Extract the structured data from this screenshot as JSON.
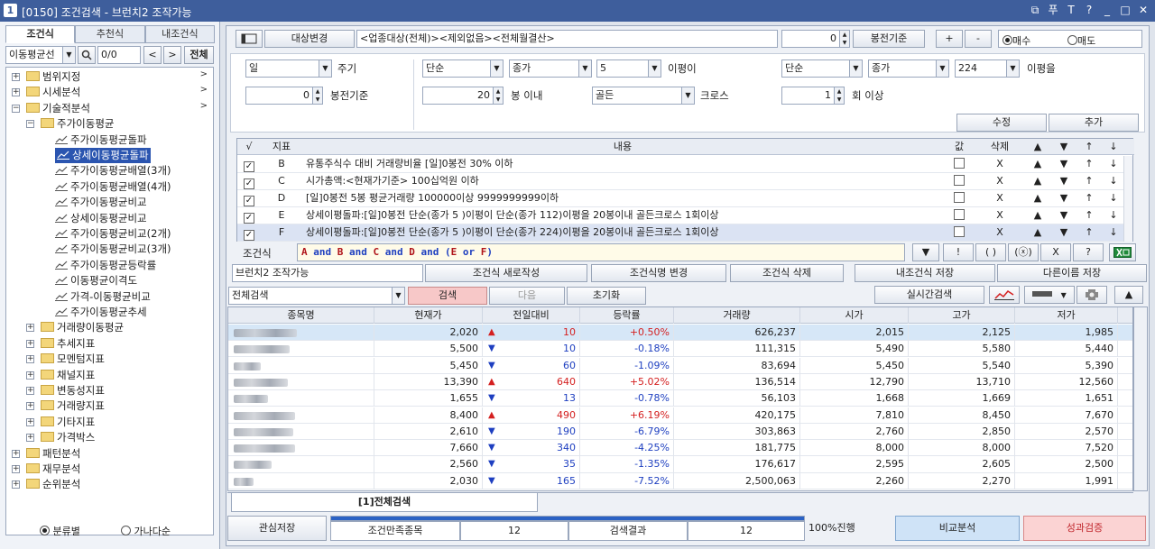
{
  "window": {
    "title": "[0150] 조건검색 - 브런치2 조작가능",
    "icon_label": "1",
    "controls": [
      "⧉",
      "푸",
      "T",
      "?",
      "_",
      "□",
      "✕"
    ]
  },
  "left": {
    "tabs": [
      "조건식",
      "추천식",
      "내조건식"
    ],
    "filter_select": "이동평균선",
    "count": "0/0",
    "prev": "<",
    "next": ">",
    "all": "전체",
    "tree": [
      {
        "label": "범위지정",
        "level": 0,
        "arrow": ">"
      },
      {
        "label": "시세분석",
        "level": 0,
        "arrow": ">"
      },
      {
        "label": "기술적분석",
        "level": 0,
        "arrow": ">"
      },
      {
        "label": "주가이동평균",
        "level": 1
      },
      {
        "label": "주가이동평균돌파",
        "level": 2
      },
      {
        "label": "상세이동평균돌파",
        "level": 2,
        "selected": true
      },
      {
        "label": "주가이동평균배열(3개)",
        "level": 2
      },
      {
        "label": "주가이동평균배열(4개)",
        "level": 2
      },
      {
        "label": "주가이동평균비교",
        "level": 2
      },
      {
        "label": "상세이동평균비교",
        "level": 2
      },
      {
        "label": "주가이동평균비교(2개)",
        "level": 2
      },
      {
        "label": "주가이동평균비교(3개)",
        "level": 2
      },
      {
        "label": "주가이동평균등락률",
        "level": 2
      },
      {
        "label": "이동평균이격도",
        "level": 2
      },
      {
        "label": "가격-이동평균비교",
        "level": 2
      },
      {
        "label": "주가이동평균추세",
        "level": 2
      },
      {
        "label": "거래량이동평균",
        "level": 1
      },
      {
        "label": "추세지표",
        "level": 1
      },
      {
        "label": "모멘텀지표",
        "level": 1
      },
      {
        "label": "채널지표",
        "level": 1
      },
      {
        "label": "변동성지표",
        "level": 1
      },
      {
        "label": "거래량지표",
        "level": 1
      },
      {
        "label": "기타지표",
        "level": 1
      },
      {
        "label": "가격박스",
        "level": 1
      },
      {
        "label": "패턴분석",
        "level": 0
      },
      {
        "label": "재무분석",
        "level": 0
      },
      {
        "label": "순위분석",
        "level": 0
      }
    ],
    "radio": [
      "분류별",
      "가나다순"
    ]
  },
  "top": {
    "target_btn": "대상변경",
    "target_text": "<업종대상(전체)><제외없음><전체월결산>",
    "bong_value": "0",
    "bong_btn": "봉전기준",
    "plus": "+",
    "minus": "-",
    "buy": "매수",
    "sell": "매도"
  },
  "form": {
    "period": "일",
    "period_lbl": "주기",
    "bong": "0",
    "bong_lbl": "봉전기준",
    "ma1_type": "단순",
    "ma1_price": "종가",
    "ma1_n": "5",
    "ma1_lbl": "이평이",
    "ma2_type": "단순",
    "ma2_price": "종가",
    "ma2_n": "224",
    "ma2_lbl": "이평을",
    "within": "20",
    "within_lbl": "봉 이내",
    "cross": "골든",
    "cross_lbl": "크로스",
    "times": "1",
    "times_lbl": "회 이상",
    "edit": "수정",
    "add": "추가"
  },
  "cond_table": {
    "headers": [
      "√",
      "지표",
      "내용",
      "값",
      "삭제",
      "▲",
      "▼",
      "↑",
      "↓"
    ],
    "rows": [
      {
        "id": "B",
        "text": "유통주식수 대비 거래량비율 [일]0봉전 30% 이하"
      },
      {
        "id": "C",
        "text": "시가총액:<현재가기준> 100십억원 이하"
      },
      {
        "id": "D",
        "text": "[일]0봉전 5봉 평균거래량 100000이상 9999999999이하"
      },
      {
        "id": "E",
        "text": "상세이평돌파:[일]0봉전 단순(종가 5 )이평이 단순(종가 112)이평을 20봉이내 골든크로스 1회이상"
      },
      {
        "id": "F",
        "text": "상세이평돌파:[일]0봉전 단순(종가 5 )이평이 단순(종가 224)이평을 20봉이내 골든크로스 1회이상"
      }
    ],
    "del": "X",
    "up": "▲",
    "dn": "▼",
    "top": "↑",
    "bot": "↓"
  },
  "formula": {
    "label": "조건식",
    "expr": "A and B and C and D and (E or F)",
    "tools": [
      "▼",
      "!",
      "( )",
      "(ⓧ)",
      "X",
      "?"
    ]
  },
  "actions": {
    "name": "브런치2 조작가능",
    "new": "조건식 새로작성",
    "rename": "조건식명 변경",
    "delete": "조건식 삭제",
    "save": "내조건식 저장",
    "saveas": "다른이름 저장"
  },
  "search": {
    "scope": "전체검색",
    "search": "검색",
    "next": "다음",
    "reset": "초기화",
    "realtime": "실시간검색"
  },
  "results": {
    "headers": [
      "종목명",
      "현재가",
      "전일대비",
      "등락률",
      "거래량",
      "시가",
      "고가",
      "저가"
    ],
    "rows": [
      {
        "price": "2,020",
        "chg": "10",
        "dir": "up",
        "rate": "+0.50%",
        "vol": "626,237",
        "open": "2,015",
        "high": "2,125",
        "low": "1,985"
      },
      {
        "price": "5,500",
        "chg": "10",
        "dir": "dn",
        "rate": "-0.18%",
        "vol": "111,315",
        "open": "5,490",
        "high": "5,580",
        "low": "5,440"
      },
      {
        "price": "5,450",
        "chg": "60",
        "dir": "dn",
        "rate": "-1.09%",
        "vol": "83,694",
        "open": "5,450",
        "high": "5,540",
        "low": "5,390"
      },
      {
        "price": "13,390",
        "chg": "640",
        "dir": "up",
        "rate": "+5.02%",
        "vol": "136,514",
        "open": "12,790",
        "high": "13,710",
        "low": "12,560"
      },
      {
        "price": "1,655",
        "chg": "13",
        "dir": "dn",
        "rate": "-0.78%",
        "vol": "56,103",
        "open": "1,668",
        "high": "1,669",
        "low": "1,651"
      },
      {
        "price": "8,400",
        "chg": "490",
        "dir": "up",
        "rate": "+6.19%",
        "vol": "420,175",
        "open": "7,810",
        "high": "8,450",
        "low": "7,670"
      },
      {
        "price": "2,610",
        "chg": "190",
        "dir": "dn",
        "rate": "-6.79%",
        "vol": "303,863",
        "open": "2,760",
        "high": "2,850",
        "low": "2,570"
      },
      {
        "price": "7,660",
        "chg": "340",
        "dir": "dn",
        "rate": "-4.25%",
        "vol": "181,775",
        "open": "8,000",
        "high": "8,000",
        "low": "7,520"
      },
      {
        "price": "2,560",
        "chg": "35",
        "dir": "dn",
        "rate": "-1.35%",
        "vol": "176,617",
        "open": "2,595",
        "high": "2,605",
        "low": "2,500"
      },
      {
        "price": "2,030",
        "chg": "165",
        "dir": "dn",
        "rate": "-7.52%",
        "vol": "2,500,063",
        "open": "2,260",
        "high": "2,270",
        "low": "1,991"
      }
    ],
    "tab": "[1]전체검색"
  },
  "footer": {
    "fav": "관심저장",
    "matched_lbl": "조건만족종목",
    "matched": "12",
    "result_lbl": "검색결과",
    "result": "12",
    "progress": "100%진행",
    "progress_value": 1.0,
    "compare": "비교분석",
    "verify": "성과검증"
  },
  "colors": {
    "up": "#d42020",
    "down": "#1e3fc0",
    "selected": "#2b55b0",
    "verify_bg": "#fbd3d3",
    "compare_bg": "#cfe3f7"
  }
}
